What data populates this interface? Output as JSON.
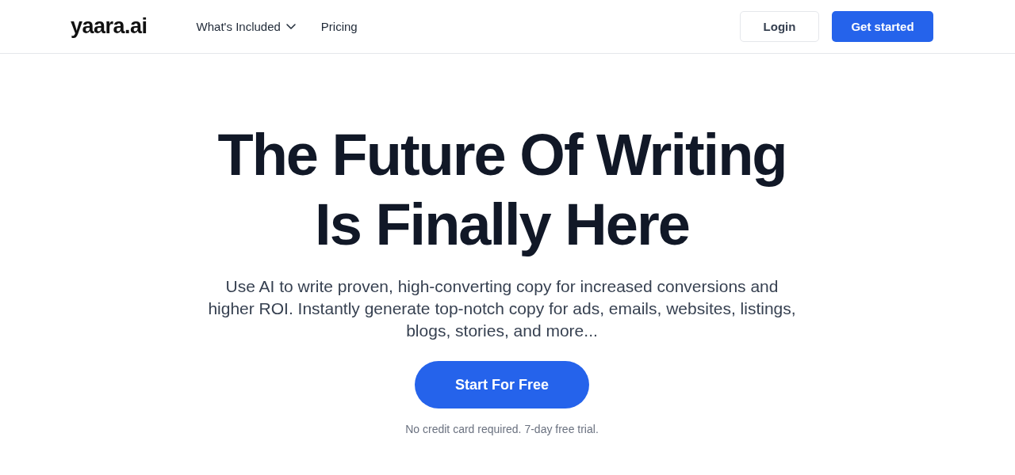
{
  "header": {
    "logo": "yaara.ai",
    "nav": [
      {
        "label": "What's Included",
        "kind": "dropdown"
      },
      {
        "label": "Pricing",
        "kind": "link"
      }
    ],
    "buttons": [
      {
        "label": "Login",
        "kind": "secondary"
      },
      {
        "label": "Get started",
        "kind": "primary"
      }
    ]
  },
  "hero": {
    "title": "The Future Of Writing Is Finally Here",
    "subtitle": "Use AI to write proven, high-converting copy for increased conversions and higher ROI. Instantly generate top-notch copy for ads, emails, websites, listings, blogs, stories, and more...",
    "cta": "Start For Free",
    "note": "No credit card required. 7-day free trial."
  }
}
